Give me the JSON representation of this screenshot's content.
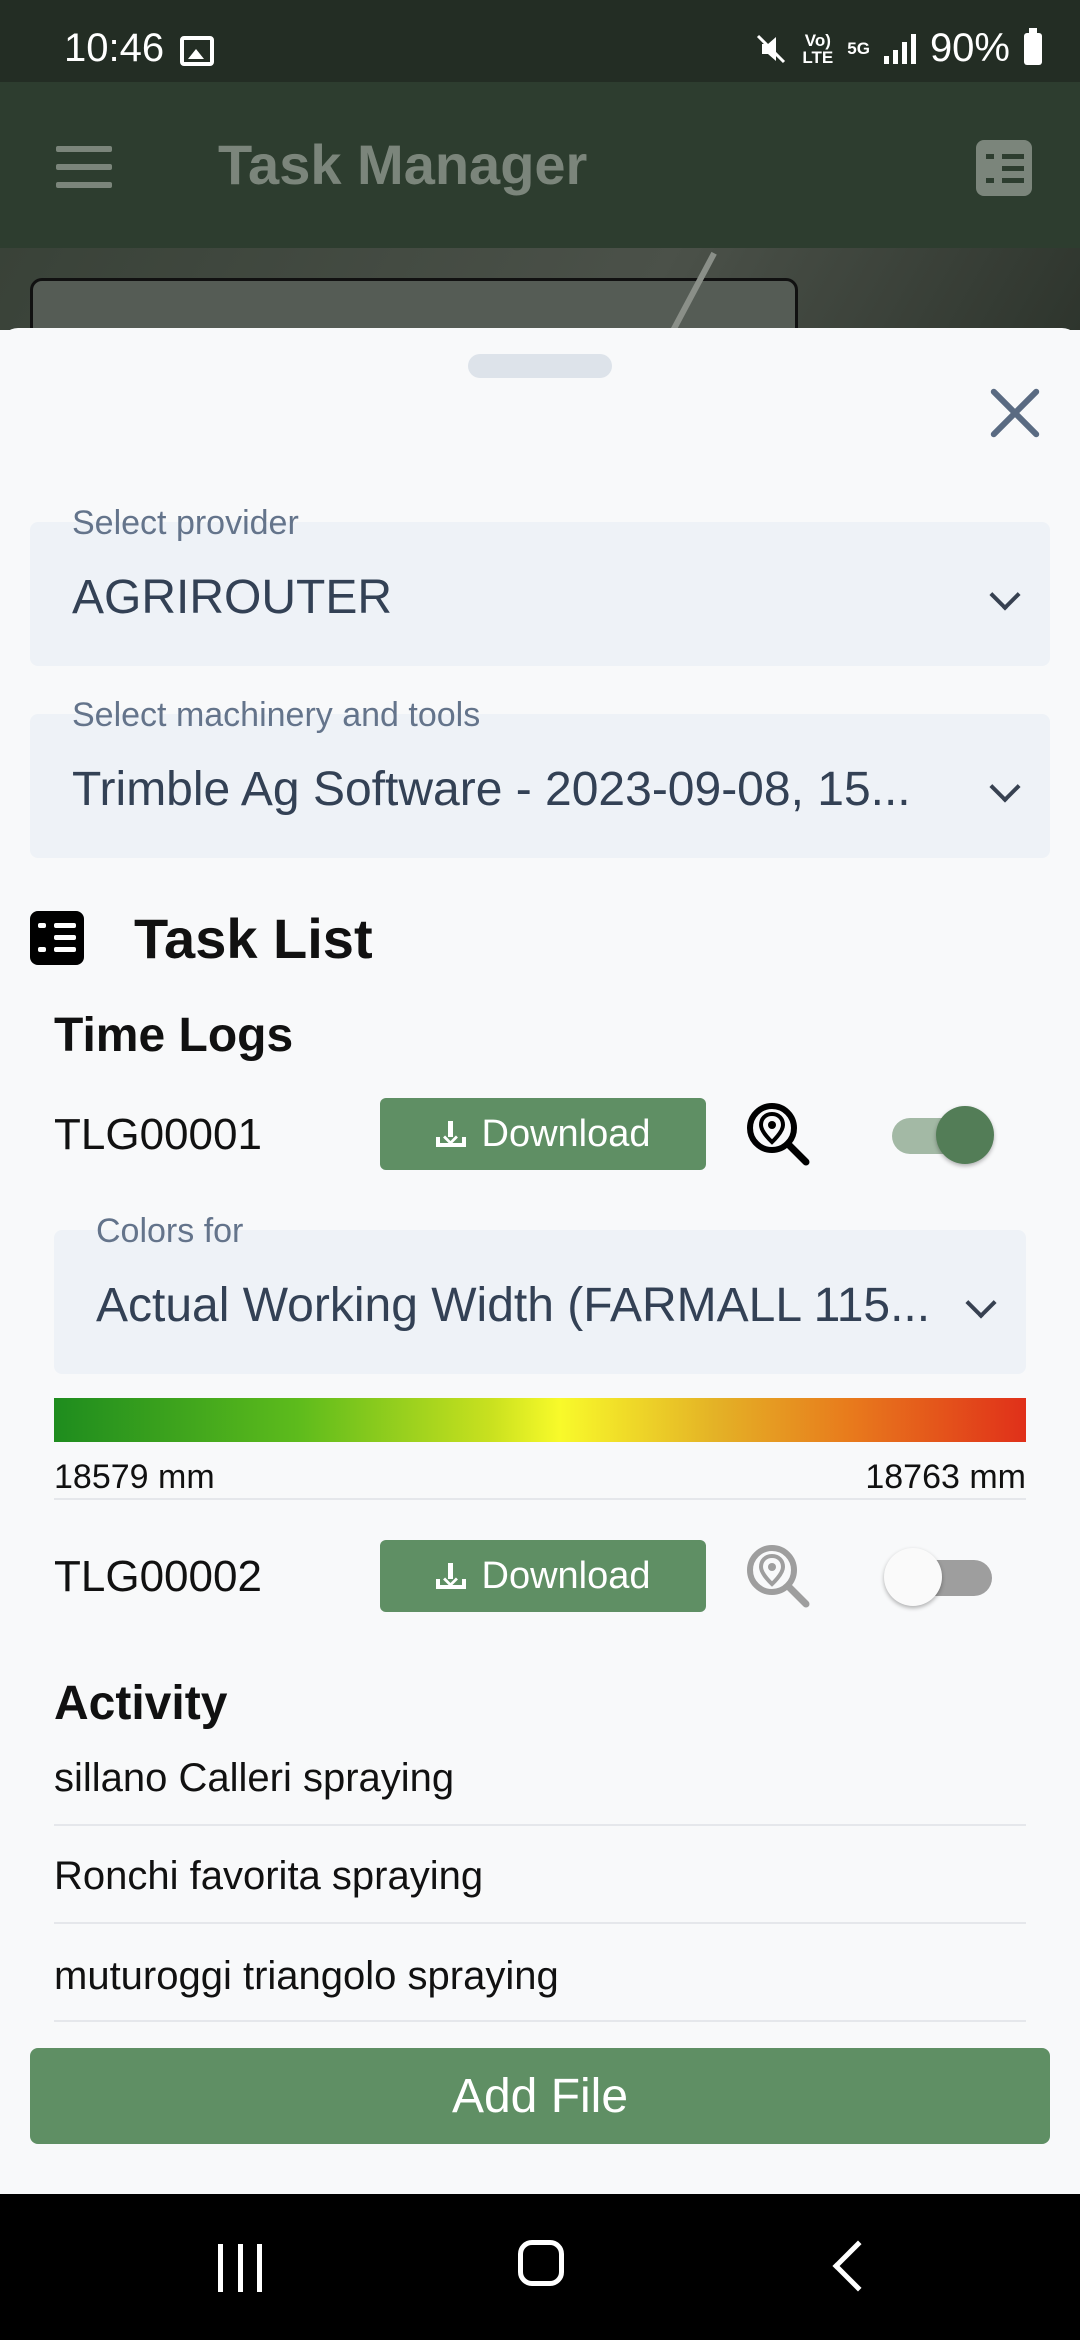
{
  "status_bar": {
    "time": "10:46",
    "volte": "Vo)\nLTE",
    "network": "5G",
    "battery": "90%"
  },
  "app_bar": {
    "title": "Task Manager"
  },
  "sheet": {
    "provider": {
      "label": "Select provider",
      "value": "AGRIROUTER"
    },
    "machinery": {
      "label": "Select machinery and tools",
      "value": "Trimble Ag Software - 2023-09-08, 15..."
    },
    "task_list_title": "Task List",
    "time_logs": {
      "title": "Time Logs",
      "items": [
        {
          "id": "TLG00001",
          "download_label": "Download",
          "enabled": true
        },
        {
          "id": "TLG00002",
          "download_label": "Download",
          "enabled": false
        }
      ],
      "colors": {
        "label": "Colors for",
        "value": "Actual Working Width (FARMALL 115..."
      },
      "range": {
        "min": "18579 mm",
        "max": "18763 mm"
      }
    },
    "activity": {
      "title": "Activity",
      "items": [
        "sillano Calleri spraying",
        "Ronchi favorita spraying",
        "muturoggi triangolo spraying"
      ]
    },
    "add_file_label": "Add File"
  },
  "colors": {
    "accent": "#5f8f64",
    "status_bar": "#232d24",
    "toggle_on_thumb": "#537d57",
    "toggle_on_track": "#a3b9a5",
    "toggle_off_track": "#9e9e9e"
  }
}
